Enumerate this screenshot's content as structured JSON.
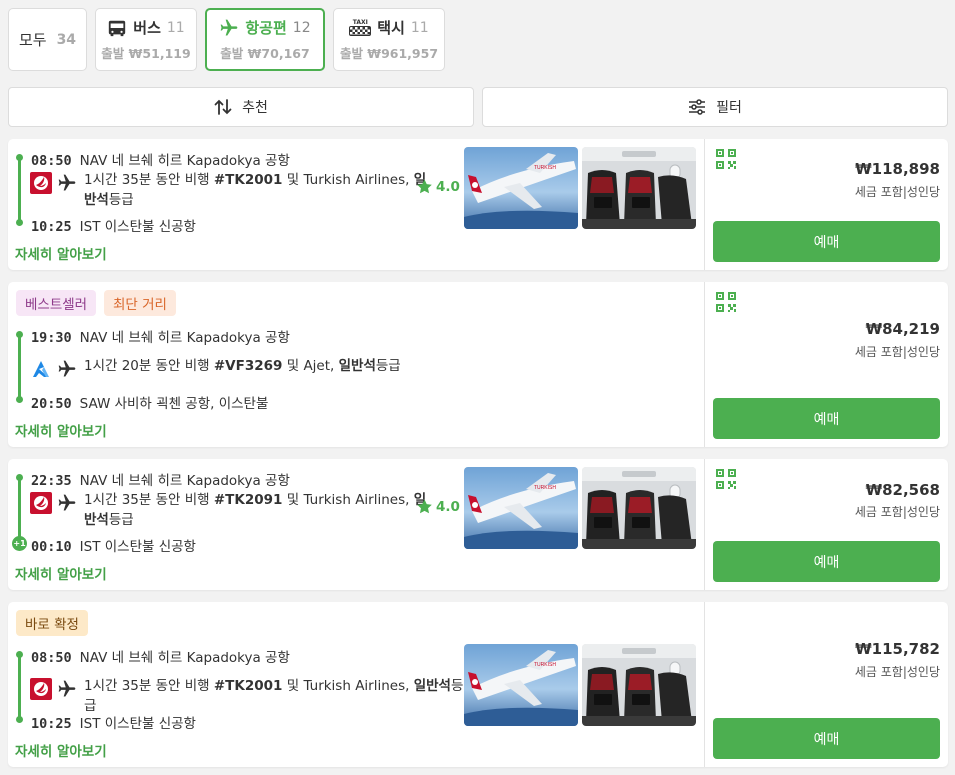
{
  "tabs": [
    {
      "name": "모두",
      "count": "34"
    },
    {
      "name": "버스",
      "count": "11",
      "sub": "출발 ₩51,119",
      "icon": "bus-icon"
    },
    {
      "name": "항공편",
      "count": "12",
      "sub": "출발 ₩70,167",
      "icon": "airplane-icon",
      "active": true
    },
    {
      "name": "택시",
      "count": "11",
      "sub": "출발 ₩961,957",
      "icon": "taxi-icon",
      "icon_text": "TAXI"
    }
  ],
  "controls": {
    "sort_label": "추천",
    "filter_label": "필터"
  },
  "colors": {
    "accent": "#4caf50",
    "turkish": "#c8102e",
    "ajet": "#1e88e5"
  },
  "results": [
    {
      "dep_time": "08:50",
      "dep_place": "NAV 네 브쉐 히르 Kapadokya 공항",
      "arr_time": "10:25",
      "arr_place": "IST 이스탄불 신공항",
      "flight_pre": "1시간 35분 동안 비행 ",
      "flight_no": "#TK2001",
      "flight_mid": " 및 Turkish Airlines, ",
      "cabin": "일반석",
      "cabin_suffix": "등급",
      "airline": "turkish-airlines-logo",
      "rating": "4.0",
      "detail": "자세히 알아보기",
      "price": "₩118,898",
      "price_note": "세금 포함|성인당",
      "book": "예매"
    },
    {
      "badges": [
        "베스트셀러",
        "최단 거리"
      ],
      "dep_time": "19:30",
      "dep_place": "NAV 네 브쉐 히르 Kapadokya 공항",
      "arr_time": "20:50",
      "arr_place": "SAW 사비하 괵첸 공항, 이스탄불",
      "flight_pre": "1시간 20분 동안 비행 ",
      "flight_no": "#VF3269",
      "flight_mid": " 및 Ajet, ",
      "cabin": "일반석",
      "cabin_suffix": "등급",
      "airline": "ajet-logo",
      "detail": "자세히 알아보기",
      "price": "₩84,219",
      "price_note": "세금 포함|성인당",
      "book": "예매"
    },
    {
      "dep_time": "22:35",
      "dep_place": "NAV 네 브쉐 히르 Kapadokya 공항",
      "arr_time": "00:10",
      "arr_place": "IST 이스탄불 신공항",
      "day_offset": "+1",
      "flight_pre": "1시간 35분 동안 비행 ",
      "flight_no": "#TK2091",
      "flight_mid": " 및 Turkish Airlines, ",
      "cabin": "일반석",
      "cabin_suffix": "등급",
      "airline": "turkish-airlines-logo",
      "rating": "4.0",
      "detail": "자세히 알아보기",
      "price": "₩82,568",
      "price_note": "세금 포함|성인당",
      "book": "예매"
    },
    {
      "badges": [
        "바로 확정"
      ],
      "dep_time": "08:50",
      "dep_place": "NAV 네 브쉐 히르 Kapadokya 공항",
      "arr_time": "10:25",
      "arr_place": "IST 이스탄불 신공항",
      "flight_pre": "1시간 35분 동안 비행 ",
      "flight_no": "#TK2001",
      "flight_mid": " 및 Turkish Airlines, ",
      "cabin": "일반석",
      "cabin_suffix": "등급",
      "airline": "turkish-airlines-logo",
      "detail": "자세히 알아보기",
      "price": "₩115,782",
      "price_note": "세금 포함|성인당",
      "book": "예매"
    }
  ]
}
